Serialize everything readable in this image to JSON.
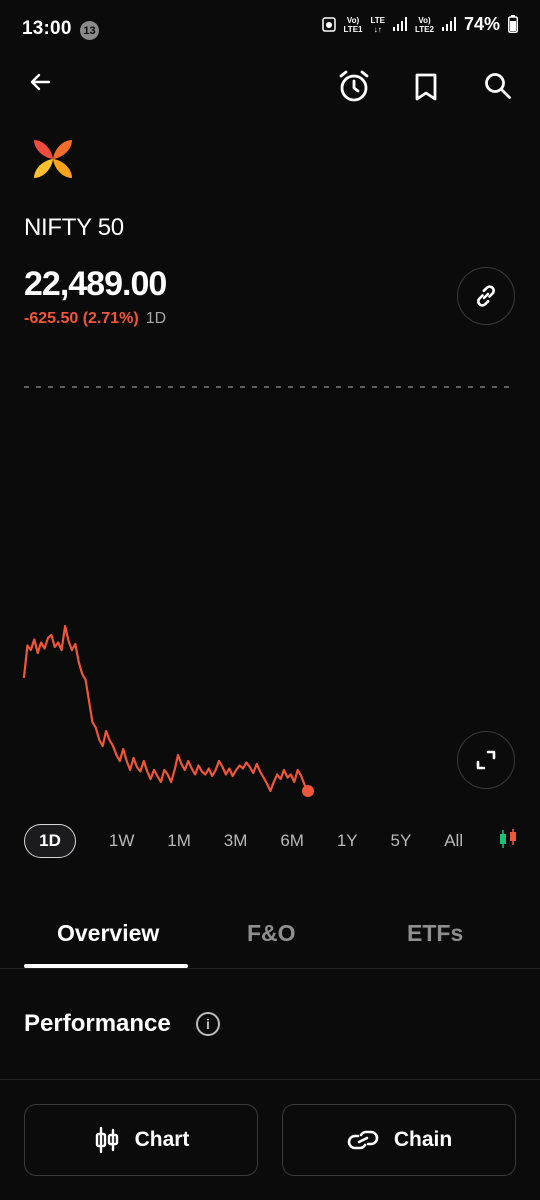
{
  "status_bar": {
    "time": "13:00",
    "notification_count": "13",
    "sim1_label_top": "Vo)",
    "sim1_label_bottom": "LTE1",
    "lte_label": "LTE",
    "sim2_label_top": "Vo)",
    "sim2_label_bottom": "LTE2",
    "battery": "74%"
  },
  "header": {
    "back_icon": "arrow-left-icon",
    "alarm_icon": "alarm-clock-icon",
    "bookmark_icon": "bookmark-icon",
    "search_icon": "search-icon"
  },
  "instrument": {
    "logo_icon": "nifty-logo-icon",
    "name": "NIFTY 50",
    "price": "22,489.00",
    "change": "-625.50 (2.71%)",
    "period": "1D",
    "link_icon": "link-icon",
    "expand_icon": "expand-icon"
  },
  "colors": {
    "background": "#0b0b0c",
    "negative": "#f0563a",
    "line": "#f0563a",
    "candle_green": "#1fbf75",
    "candle_red": "#f0563a"
  },
  "chart_data": {
    "type": "line",
    "series": [
      {
        "values": [
          22870,
          22975,
          22960,
          22995,
          22950,
          22985,
          22965,
          23000,
          23010,
          22970,
          22985,
          22960,
          23040,
          22990,
          22960,
          22980,
          22920,
          22880,
          22860,
          22790,
          22720,
          22700,
          22660,
          22640,
          22690,
          22660,
          22640,
          22610,
          22590,
          22630,
          22590,
          22560,
          22600,
          22570,
          22555,
          22590,
          22555,
          22530,
          22560,
          22540,
          22520,
          22560,
          22545,
          22520,
          22560,
          22610,
          22580,
          22560,
          22590,
          22565,
          22545,
          22575,
          22555,
          22545,
          22565,
          22540,
          22560,
          22590,
          22570,
          22545,
          22565,
          22540,
          22560,
          22575,
          22565,
          22585,
          22570,
          22550,
          22580,
          22555,
          22535,
          22515,
          22490,
          22520,
          22545,
          22530,
          22560,
          22535,
          22545,
          22520,
          22560,
          22540,
          22510,
          22490
        ],
        "last_point_marker": true
      }
    ],
    "ylim": [
      22460,
      23060
    ],
    "baseline_dashed": true,
    "grid": false
  },
  "range_selector": {
    "options": [
      "1D",
      "1W",
      "1M",
      "3M",
      "6M",
      "1Y",
      "5Y",
      "All"
    ],
    "selected": "1D",
    "candle_icon": "candlestick-icon"
  },
  "tabs": {
    "items": [
      "Overview",
      "F&O",
      "ETFs"
    ],
    "selected": "Overview"
  },
  "performance": {
    "title": "Performance",
    "info_icon": "info-icon"
  },
  "bottom_actions": {
    "chart_label": "Chart",
    "chart_icon": "candle-chart-icon",
    "chain_label": "Chain",
    "chain_icon": "link-icon"
  }
}
